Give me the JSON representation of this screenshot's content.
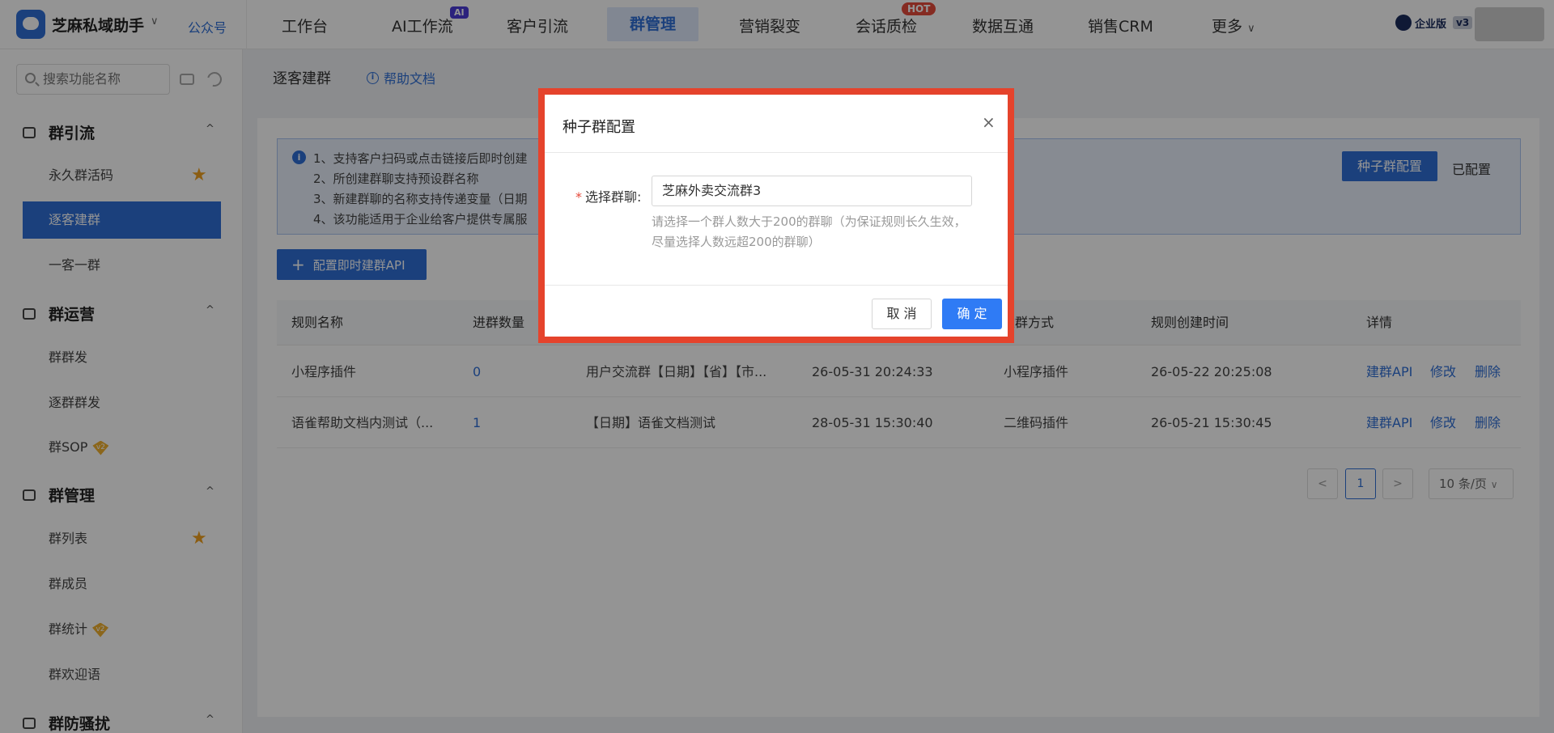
{
  "app": {
    "name": "芝麻私域助手",
    "caret": "∨",
    "gzh": "公众号"
  },
  "nav": {
    "items": [
      "工作台",
      "AI工作流",
      "客户引流",
      "群管理",
      "营销裂变",
      "会话质检",
      "数据互通",
      "销售CRM",
      "更多"
    ],
    "active": "群管理",
    "badge_ai": "AI",
    "badge_hot": "HOT",
    "more_caret": "∨",
    "enterprise": "企业版",
    "version": "v3"
  },
  "sidebar": {
    "search_placeholder": "搜索功能名称",
    "groups": [
      {
        "title": "群引流",
        "items": [
          "永久群活码",
          "逐客建群",
          "一客一群"
        ]
      },
      {
        "title": "群运营",
        "items": [
          "群群发",
          "逐群群发",
          "群SOP"
        ]
      },
      {
        "title": "群管理",
        "items": [
          "群列表",
          "群成员",
          "群统计",
          "群欢迎语"
        ]
      },
      {
        "title": "群防骚扰",
        "items": []
      }
    ],
    "active_item": "逐客建群",
    "caret": "^",
    "vip_mark": "v2"
  },
  "page": {
    "title": "逐客建群",
    "help": "帮助文档",
    "notice": [
      "1、支持客户扫码或点击链接后即时创建",
      "2、所创建群聊支持预设群名称",
      "3、新建群聊的名称支持传递变量（日期",
      "4、该功能适用于企业给客户提供专属服"
    ],
    "seed_button": "种子群配置",
    "configured": "已配置",
    "api_button": "配置即时建群API",
    "api_plus": "+"
  },
  "table": {
    "headers": [
      "规则名称",
      "进群数量",
      "",
      "",
      "建群方式",
      "规则创建时间",
      "详情"
    ],
    "rows": [
      {
        "name": "小程序插件",
        "count": "0",
        "group": "用户交流群【日期】【省】【市...",
        "time1": "26-05-31 20:24:33",
        "method": "小程序插件",
        "created": "26-05-22 20:25:08"
      },
      {
        "name": "语雀帮助文档内测试（...",
        "count": "1",
        "group": "【日期】语雀文档测试",
        "time1": "28-05-31 15:30:40",
        "method": "二维码插件",
        "created": "26-05-21 15:30:45"
      }
    ],
    "actions": [
      "建群API",
      "修改",
      "删除"
    ]
  },
  "pager": {
    "prev": "<",
    "current": "1",
    "next": ">",
    "size": "10 条/页",
    "size_caret": "∨"
  },
  "modal": {
    "title": "种子群配置",
    "close": "×",
    "required_mark": "*",
    "label": "选择群聊:",
    "value": "芝麻外卖交流群3",
    "hint": "请选择一个群人数大于200的群聊（为保证规则长久生效，尽量选择人数远超200的群聊）",
    "cancel": "取 消",
    "ok": "确 定"
  },
  "colors": {
    "accent": "#2f6fd6",
    "highlight": "#e5432c",
    "hot": "#e64a3b",
    "ai": "#4b3bd8",
    "star": "#f0a020"
  }
}
